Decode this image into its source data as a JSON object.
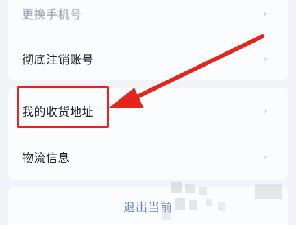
{
  "settings": {
    "change_phone": "更换手机号",
    "delete_account": "彻底注销账号",
    "my_address": "我的收货地址",
    "logistics": "物流信息",
    "logout": "退出当前"
  },
  "icons": {
    "chevron": "chevron-right-icon",
    "arrow": "pointer-arrow",
    "highlight": "highlight-box"
  },
  "colors": {
    "annotation": "#e5251d",
    "logout_text": "#4a6fd8",
    "background": "#f2f4f9",
    "card": "#fbfcfe"
  }
}
